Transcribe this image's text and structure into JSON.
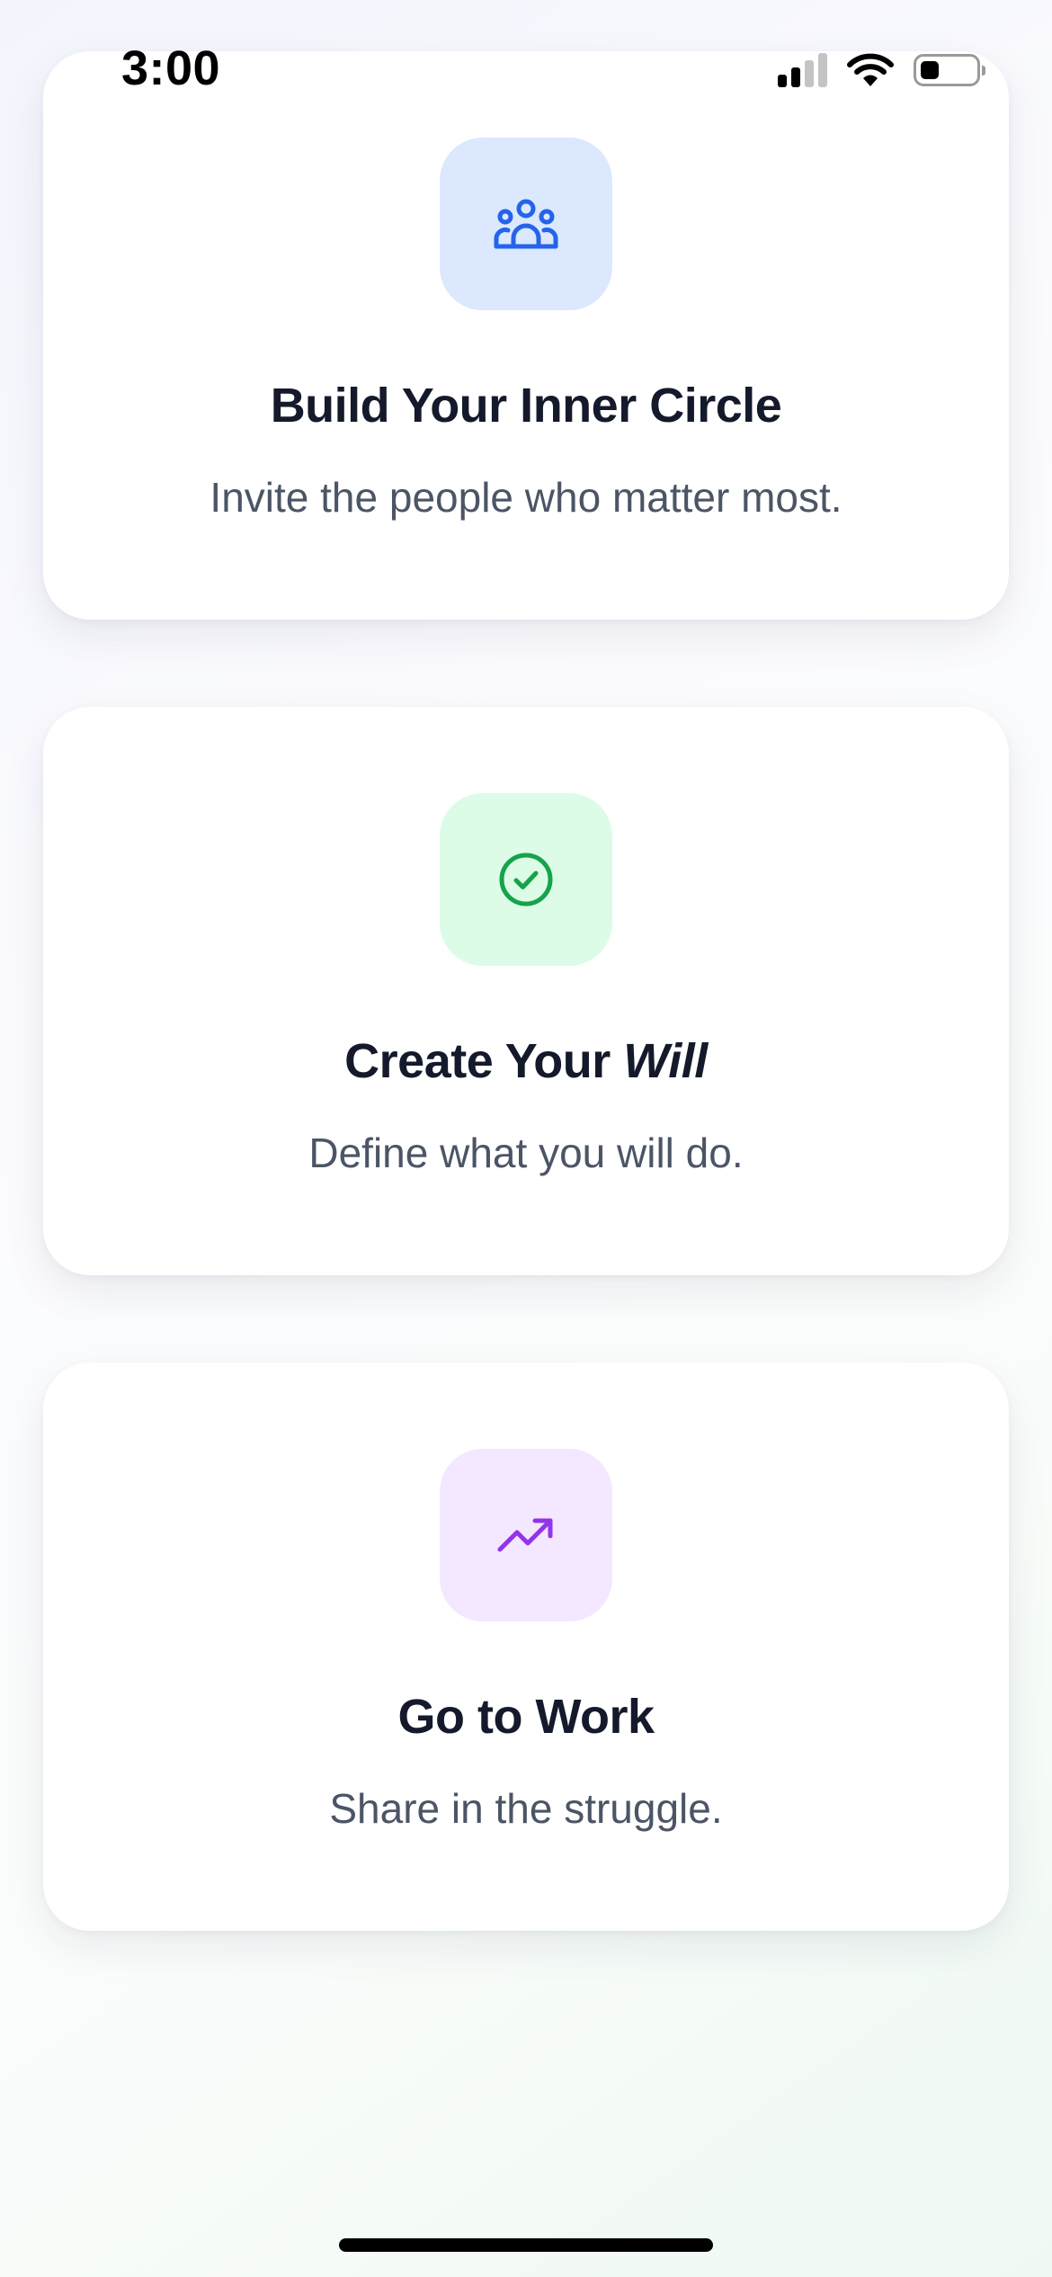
{
  "status_bar": {
    "time": "3:00",
    "signal_icon": "cellular-signal-icon",
    "wifi_icon": "wifi-icon",
    "battery_icon": "battery-icon",
    "battery_level": 0.35
  },
  "cards": [
    {
      "icon": "users-group-icon",
      "icon_color": "#2563eb",
      "tile_color": "#dbe8fe",
      "title": "Build Your Inner Circle",
      "subtitle": "Invite the people who matter most."
    },
    {
      "icon": "check-circle-icon",
      "icon_color": "#16a34a",
      "tile_color": "#dcfce7",
      "title_prefix": "Create Your ",
      "title_emphasis": "Will",
      "subtitle": "Define what you will do."
    },
    {
      "icon": "trending-up-icon",
      "icon_color": "#9333ea",
      "tile_color": "#f3e8ff",
      "title": "Go to Work",
      "subtitle": "Share in the struggle."
    }
  ]
}
